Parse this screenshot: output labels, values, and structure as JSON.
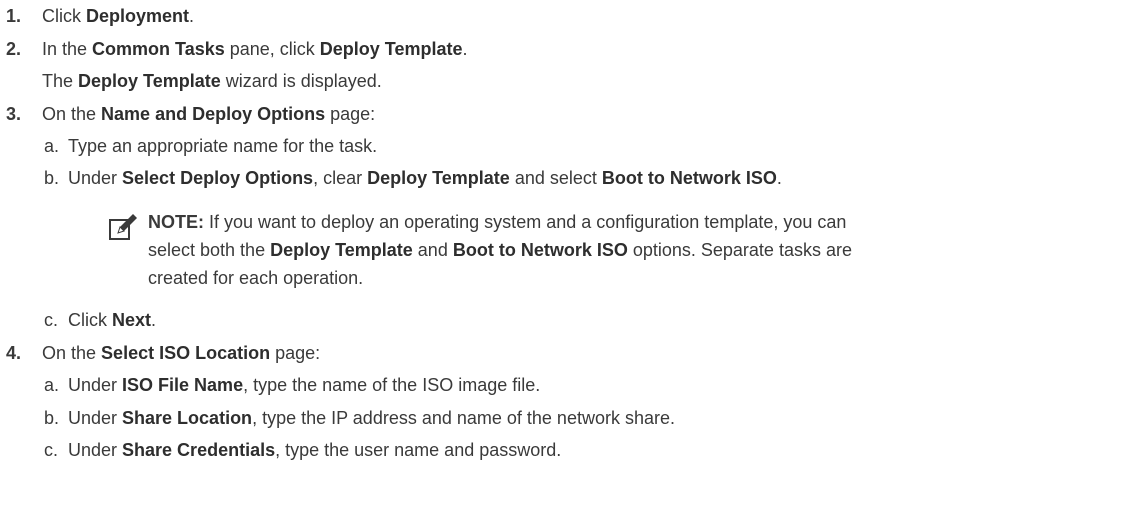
{
  "steps": [
    {
      "number": "1.",
      "parts": [
        "Click ",
        "Deployment",
        "."
      ]
    },
    {
      "number": "2.",
      "parts": [
        "In the ",
        "Common Tasks",
        " pane, click ",
        "Deploy Template",
        "."
      ],
      "continuation": [
        "The ",
        "Deploy Template",
        " wizard is displayed."
      ]
    },
    {
      "number": "3.",
      "parts": [
        "On the ",
        "Name and Deploy Options",
        " page:"
      ],
      "substeps": [
        {
          "letter": "a.",
          "parts": [
            "Type an appropriate name for the task."
          ]
        },
        {
          "letter": "b.",
          "parts": [
            "Under ",
            "Select Deploy Options",
            ", clear ",
            "Deploy Template",
            " and select ",
            "Boot to Network ISO",
            "."
          ]
        },
        {
          "letter": "c.",
          "parts": [
            "Click ",
            "Next",
            "."
          ]
        }
      ],
      "note": {
        "icon": "pencil-note-icon",
        "label": "NOTE:",
        "lines": [
          [
            " If you want to deploy an operating system and a configuration template, you can"
          ],
          [
            "select both the ",
            "Deploy Template",
            " and ",
            "Boot to Network ISO",
            " options. Separate tasks are"
          ],
          [
            "created for each operation."
          ]
        ]
      }
    },
    {
      "number": "4.",
      "parts": [
        "On the ",
        "Select ISO Location",
        " page:"
      ],
      "substeps": [
        {
          "letter": "a.",
          "parts": [
            "Under ",
            "ISO File Name",
            ", type the name of the ISO image file."
          ]
        },
        {
          "letter": "b.",
          "parts": [
            "Under ",
            "Share Location",
            ", type the IP address and name of the network share."
          ]
        },
        {
          "letter": "c.",
          "parts": [
            "Under ",
            "Share Credentials",
            ", type the user name and password."
          ]
        }
      ]
    }
  ]
}
